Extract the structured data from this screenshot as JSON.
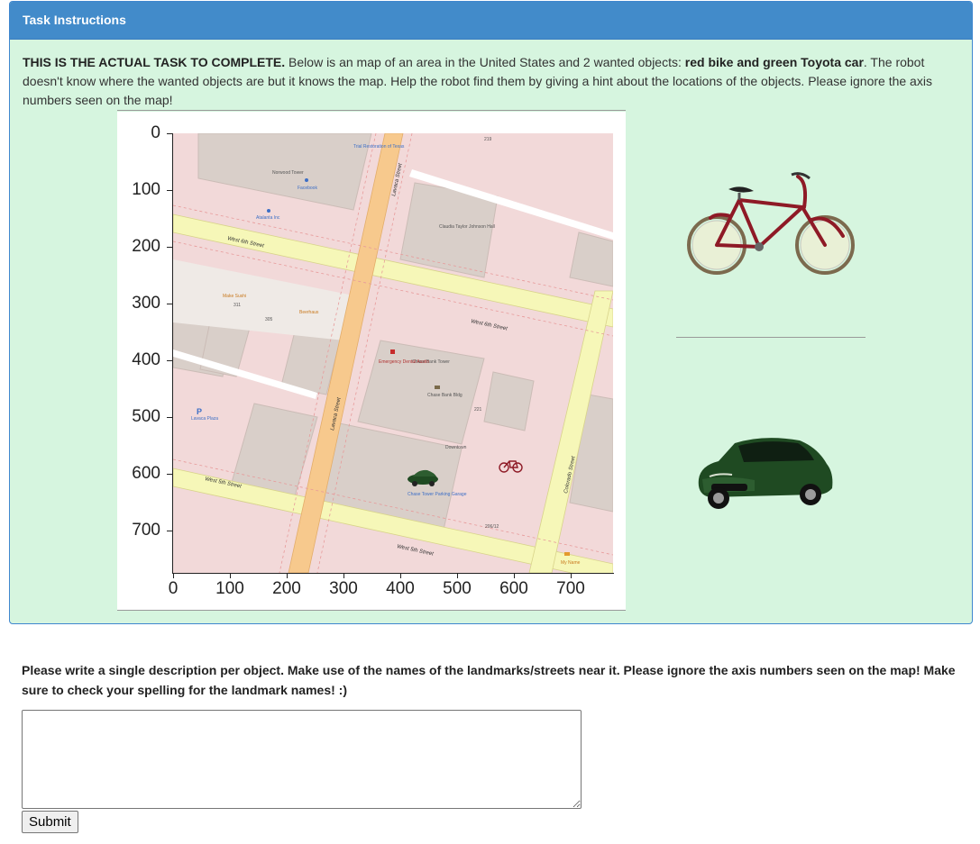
{
  "panel": {
    "title": "Task Instructions",
    "lead_bold": "THIS IS THE ACTUAL TASK TO COMPLETE.",
    "text_1": " Below is an map of an area in the United States and 2 wanted objects: ",
    "objects_bold": "red bike and green Toyota car",
    "text_2": ". The robot doesn't know where the wanted objects are but it knows the map. Help the robot find them by giving a hint about the locations of the objects. Please ignore the axis numbers seen on the map!"
  },
  "figure": {
    "y_ticks": [
      "0",
      "100",
      "200",
      "300",
      "400",
      "500",
      "600",
      "700"
    ],
    "x_ticks": [
      "0",
      "100",
      "200",
      "300",
      "400",
      "500",
      "600",
      "700"
    ],
    "map_labels": {
      "norwood": "Norwood Tower",
      "facebook": "Facebook",
      "atalanta": "Atalanta Inc",
      "west_6th_a": "West 6th Street",
      "west_6th_b": "West 6th Street",
      "west_5th_a": "West 5th Street",
      "west_5th_b": "West 5th Street",
      "lavaca_a": "Lavaca Street",
      "lavaca_b": "Lavaca Street",
      "colorado": "Colorado Street",
      "claudia": "Claudia Taylor Johnson Hall",
      "chase_tower": "Chase Bank Tower",
      "chase_bldg": "Chase Bank Bldg",
      "emergency": "Emergency Dental Austin",
      "downtown": "Downtown",
      "parking": "Chase Tower Parking Garage",
      "lavaca_plaza": "Lavaca Plaza",
      "make_sushi": "Make Sushi",
      "beerhaus": "Beerhaus",
      "my_name": "My Name",
      "trial_restoration": "Trial Restoration of Texas",
      "n219": "219",
      "n221": "221",
      "n311": "311",
      "n305": "305",
      "n206": "206/12"
    },
    "wanted_objects": [
      "red-bike",
      "green-toyota-car"
    ]
  },
  "form": {
    "prompt": "Please write a single description per object. Make use of the names of the landmarks/streets near it. Please ignore the axis numbers seen on the map! Make sure to check your spelling for the landmark names! :)",
    "answer_value": "",
    "submit_label": "Submit"
  },
  "colors": {
    "panel_bg": "#d6f5df",
    "heading_bg": "#428bca",
    "map_block": "#d9cfc9",
    "map_bg": "#f2d9d9",
    "major_road": "#f7c98d",
    "minor_road": "#f6f7b8",
    "bike_red": "#8e1a26",
    "car_green": "#1f4a22"
  }
}
